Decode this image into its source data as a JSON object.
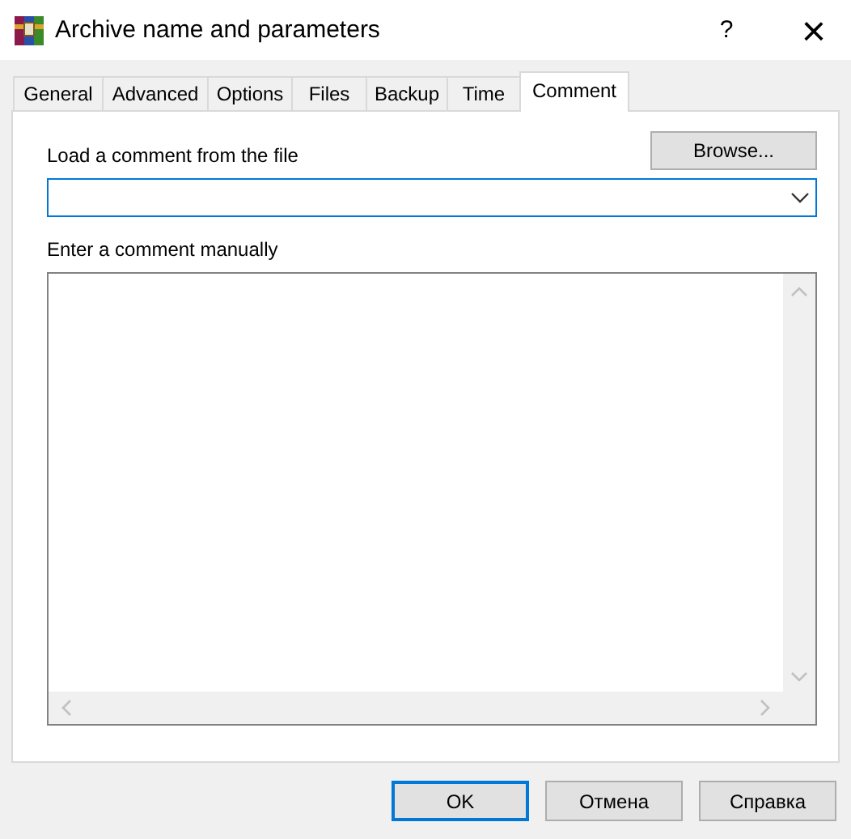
{
  "window": {
    "title": "Archive name and parameters",
    "help": "?",
    "close": "×"
  },
  "tabs": [
    {
      "label": "General",
      "selected": false
    },
    {
      "label": "Advanced",
      "selected": false
    },
    {
      "label": "Options",
      "selected": false
    },
    {
      "label": "Files",
      "selected": false
    },
    {
      "label": "Backup",
      "selected": false
    },
    {
      "label": "Time",
      "selected": false
    },
    {
      "label": "Comment",
      "selected": true
    }
  ],
  "load_label": "Load a comment from the file",
  "browse_button": "Browse...",
  "manual_label": "Enter a comment manually",
  "buttons": [
    {
      "label": "OK",
      "default": true
    },
    {
      "label": "Отмена",
      "default": false
    },
    {
      "label": "Справка",
      "default": false
    }
  ]
}
